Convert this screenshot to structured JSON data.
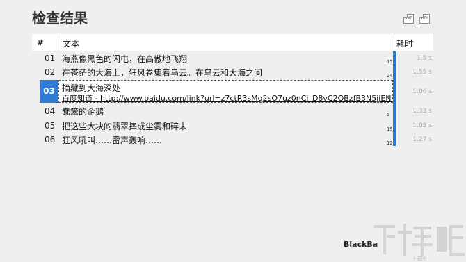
{
  "page": {
    "title": "检查结果"
  },
  "toolbar": {
    "icon1": "TXT",
    "icon2": "HTM"
  },
  "table": {
    "headers": {
      "num": "#",
      "text": "文本",
      "time": "耗时"
    },
    "rows": [
      {
        "num": "01",
        "text": "海燕像黑色的闪电，在高傲地飞翔",
        "count": "15",
        "time": "1.5 s"
      },
      {
        "num": "02",
        "text": "在苍茫的大海上，狂风卷集着乌云。在乌云和大海之间",
        "count": "24",
        "time": "1.55 s"
      },
      {
        "num": "03",
        "text": "摘藏到大海深处",
        "link": "百度知道 - http://www.baidu.com/link?url=z7ctR3sMq2sO7uz0nCi_D8vC2OBzfB3N5jjEN51pp97...",
        "count": "7",
        "time": "1.06 s",
        "selected": true
      },
      {
        "num": "04",
        "text": "蠢笨的企鹅",
        "count": "5",
        "time": "1.33 s"
      },
      {
        "num": "05",
        "text": "把这些大块的翡翠摔成尘雾和碎末",
        "count": "15",
        "time": "1.03 s"
      },
      {
        "num": "06",
        "text": "狂风吼叫……雷声轰响……",
        "count": "12",
        "time": "1.27 s"
      }
    ]
  },
  "footer": {
    "text": "BlackBa"
  },
  "watermark": {
    "text": "下载吧"
  },
  "colors": {
    "accent": "#2f7bd6",
    "background": "#efefef"
  }
}
